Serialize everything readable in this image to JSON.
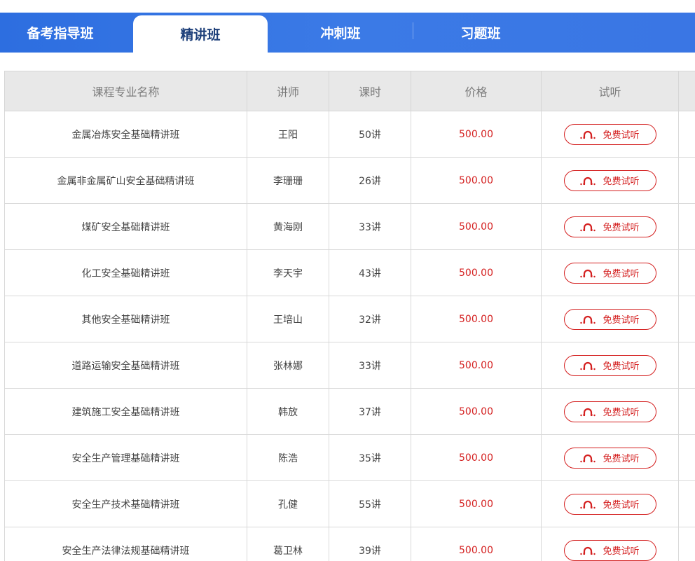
{
  "tabs": [
    {
      "label": "备考指导班",
      "active": false
    },
    {
      "label": "精讲班",
      "active": true
    },
    {
      "label": "冲刺班",
      "active": false
    },
    {
      "label": "习题班",
      "active": false
    }
  ],
  "table": {
    "headers": [
      "课程专业名称",
      "讲师",
      "课时",
      "价格",
      "试听",
      ""
    ],
    "listen_label": "免费试听",
    "listen_icon": "headphones-icon",
    "rows": [
      {
        "name": "金属冶炼安全基础精讲班",
        "teacher": "王阳",
        "hours": "50讲",
        "price": "500.00"
      },
      {
        "name": "金属非金属矿山安全基础精讲班",
        "teacher": "李珊珊",
        "hours": "26讲",
        "price": "500.00"
      },
      {
        "name": "煤矿安全基础精讲班",
        "teacher": "黄海刚",
        "hours": "33讲",
        "price": "500.00"
      },
      {
        "name": "化工安全基础精讲班",
        "teacher": "李天宇",
        "hours": "43讲",
        "price": "500.00"
      },
      {
        "name": "其他安全基础精讲班",
        "teacher": "王培山",
        "hours": "32讲",
        "price": "500.00"
      },
      {
        "name": "道路运输安全基础精讲班",
        "teacher": "张林娜",
        "hours": "33讲",
        "price": "500.00"
      },
      {
        "name": "建筑施工安全基础精讲班",
        "teacher": "韩放",
        "hours": "37讲",
        "price": "500.00"
      },
      {
        "name": "安全生产管理基础精讲班",
        "teacher": "陈浩",
        "hours": "35讲",
        "price": "500.00"
      },
      {
        "name": "安全生产技术基础精讲班",
        "teacher": "孔健",
        "hours": "55讲",
        "price": "500.00"
      },
      {
        "name": "安全生产法律法规基础精讲班",
        "teacher": "葛卫林",
        "hours": "39讲",
        "price": "500.00"
      }
    ]
  },
  "colors": {
    "tab_bar": "#3474e3",
    "active_tab_text": "#1d3f7a",
    "header_bg": "#e8e8e8",
    "price": "#d42020",
    "listen_border": "#d42020"
  }
}
